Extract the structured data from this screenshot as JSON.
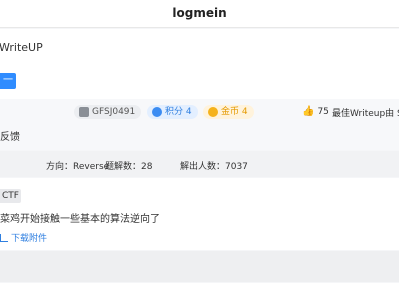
{
  "header": {
    "title": "logmein"
  },
  "writeup": {
    "title": "WriteUP",
    "next_label": "一题"
  },
  "author": {
    "username": "GFSJ0491",
    "score": "积分 4",
    "coin": "金币 4",
    "likes": "75",
    "best": "最佳Writeup由 S",
    "feedback": "反馈",
    "icons": {
      "user": "user-avatar-icon",
      "score": "diamond-icon",
      "coin": "coin-icon",
      "like": "thumb-up-icon"
    }
  },
  "stats": {
    "direction": "方向：Reverse",
    "solves": "题解数：28",
    "solvers": "解出人数：7037"
  },
  "challenge": {
    "badge": "CTF",
    "description": "菜鸡开始接触一些基本的算法逆向了",
    "download": "下载附件",
    "download_icon": "download-icon"
  },
  "colors": {
    "accent": "#2f8cff",
    "score": "#3b8cf2",
    "coin": "#f5b21b"
  }
}
